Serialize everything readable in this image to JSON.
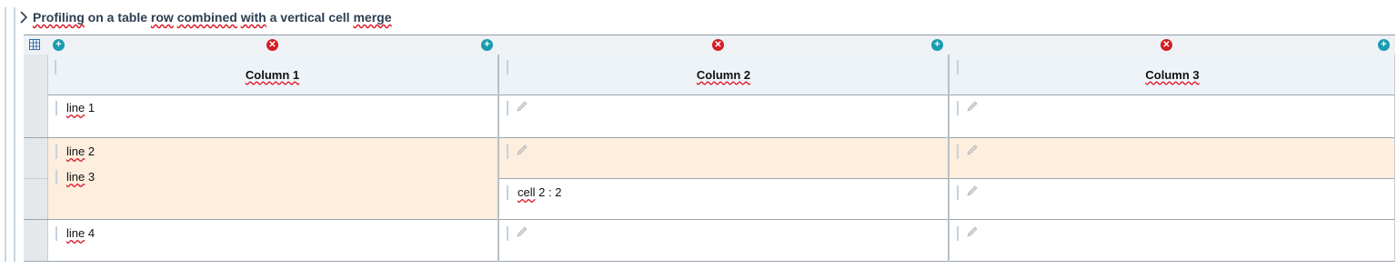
{
  "section": {
    "title_part1": "Profiling",
    "title_part2": "on a table",
    "title_part3": "row",
    "title_part4": "combined",
    "title_part5": "with",
    "title_part6": "a vertical cell",
    "title_part7": "merge"
  },
  "table": {
    "columns": [
      {
        "label": "Column 1"
      },
      {
        "label": "Column 2"
      },
      {
        "label": "Column 3"
      }
    ],
    "rows": [
      {
        "c1": "line 1",
        "c1_word": "line",
        "c1_num": "1"
      },
      {
        "c1_word": "line",
        "c1_num": "2"
      },
      {
        "c1_word": "line",
        "c1_num": "3",
        "c2_word": "cell",
        "c2_rest": "2 : 2"
      },
      {
        "c1_word": "line",
        "c1_num": "4"
      }
    ]
  },
  "icons": [
    "table-icon",
    "add-column-icon",
    "delete-column-icon",
    "pencil-icon",
    "chevron-right-icon"
  ],
  "colors": {
    "add": "#1a9bb0",
    "delete": "#d21e25",
    "highlight": "#fdeede",
    "header_bg": "#eef3f7"
  }
}
